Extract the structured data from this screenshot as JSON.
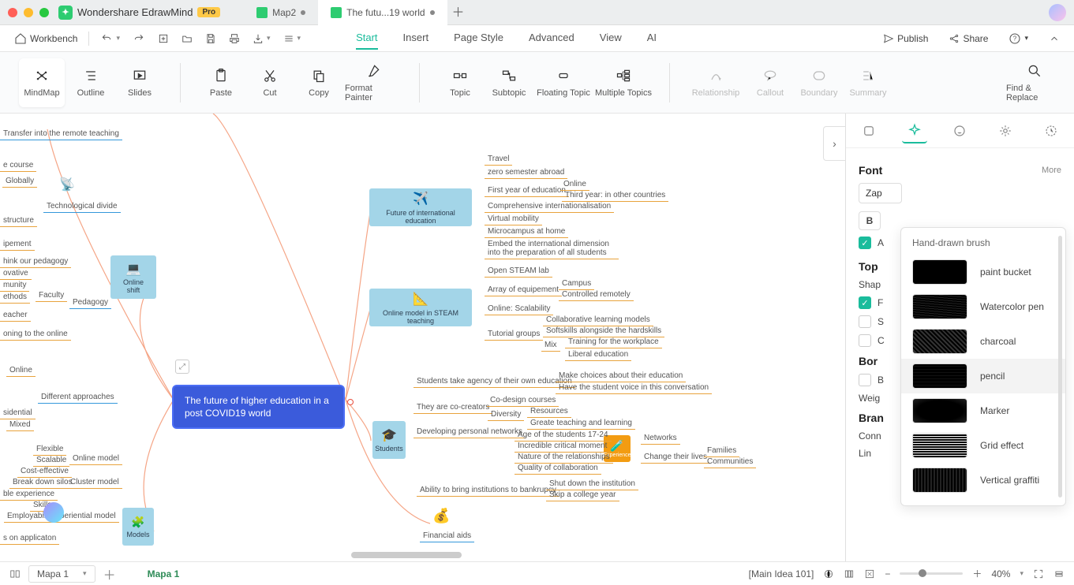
{
  "titlebar": {
    "app_name": "Wondershare EdrawMind",
    "pro": "Pro",
    "tabs": [
      {
        "label": "Map2",
        "active": false,
        "dirty": true
      },
      {
        "label": "The futu...19 world",
        "active": true,
        "dirty": true
      }
    ]
  },
  "menubar": {
    "workbench": "Workbench",
    "tabs": [
      "Start",
      "Insert",
      "Page Style",
      "Advanced",
      "View",
      "AI"
    ],
    "active_tab": "Start",
    "publish": "Publish",
    "share": "Share"
  },
  "toolbar": {
    "mindmap": "MindMap",
    "outline": "Outline",
    "slides": "Slides",
    "paste": "Paste",
    "cut": "Cut",
    "copy": "Copy",
    "format_painter": "Format Painter",
    "topic": "Topic",
    "subtopic": "Subtopic",
    "floating": "Floating Topic",
    "multiple": "Multiple Topics",
    "relationship": "Relationship",
    "callout": "Callout",
    "boundary": "Boundary",
    "summary": "Summary",
    "find": "Find & Replace"
  },
  "main": {
    "title": "The future of higher education in a post COVID19 world"
  },
  "topics": {
    "online_shift": "Online shift",
    "models": "Models",
    "students": "Students",
    "future_intl": "Future of international education",
    "online_steam": "Online model in STEAM teaching",
    "financial": "Financial aids",
    "experience": "Experience"
  },
  "left_nodes": {
    "transfer": "Transfer into the remote teaching",
    "course": "e course",
    "globally": "Globally",
    "structure": "structure",
    "ipement": "ipement",
    "tech_divide": "Technological divide",
    "hink": "hink our pedagogy",
    "ovative": "ovative",
    "munity": "munity",
    "ethods": "ethods",
    "eacher": "eacher",
    "oning": "oning to the online",
    "faculty": "Faculty",
    "pedagogy": "Pedagogy",
    "online": "Online",
    "diff": "Different approaches",
    "sidential": "sidential",
    "mixed": "Mixed",
    "flexible": "Flexible",
    "scalable": "Scalable",
    "cost": "Cost-effective",
    "break": "Break down silos",
    "ble": "ble experience",
    "skills": "Skills",
    "employ": "Employability",
    "app": "s on applicaton",
    "online_model": "Online model",
    "cluster": "Cluster model",
    "periential": "periential model"
  },
  "right_nodes": {
    "travel": "Travel",
    "zero": "zero semester abroad",
    "first_year": "First year of education",
    "online": "Online",
    "third_year": "Third year: in other countries",
    "compr": "Comprehensive internationalisation",
    "vm": "Virtual mobility",
    "micro": "Microcampus at home",
    "embed": "Embed the international dimension into the preparation of all students",
    "open": "Open STEAM lab",
    "array": "Array of equipement",
    "campus": "Campus",
    "remote": "Controlled remotely",
    "scal": "Online: Scalability",
    "tutorial": "Tutorial groups",
    "collab": "Collaborative learning models",
    "soft": "Softskills alongside the hardskills",
    "mix": "Mix",
    "training": "Training for the workplace",
    "liberal": "Liberal education",
    "agency": "Students take agency of their own education",
    "make": "Make choices about their education",
    "voice": "Have the student voice in this conversation",
    "cocreators": "They are co-creators",
    "codesign": "Co-design courses",
    "diversity": "Diversity",
    "resources": "Resources",
    "greate": "Greate teaching and learning",
    "develop": "Developing personal networks",
    "age": "Age of the students 17-24",
    "critical": "Incredible critical moment",
    "nature": "Nature of the relationships",
    "quality": "Quality of collaboration",
    "networks": "Networks",
    "change": "Change their lives",
    "families": "Families",
    "communities": "Communities",
    "bring": "Ability to bring institutions to bankrupcy",
    "shut": "Shut down the institution",
    "skip": "Skip a college year"
  },
  "rpanel": {
    "font": "Font",
    "more": "More",
    "font_name": "Zap",
    "auto": "A",
    "auto_on": true,
    "topics": "Top",
    "shape": "Shap",
    "f_on": true,
    "s": "S",
    "c": "C",
    "border": "Bor",
    "b": "B",
    "weight": "Weig",
    "branch": "Bran",
    "conn": "Conn",
    "lin": "Lin"
  },
  "brush": {
    "title": "Hand-drawn brush",
    "items": [
      "paint bucket",
      "Watercolor pen",
      "charcoal",
      "pencil",
      "Marker",
      "Grid effect",
      "Vertical graffiti"
    ],
    "selected": "pencil"
  },
  "status": {
    "sheet": "Mapa 1",
    "sheet_active": "Mapa 1",
    "mainidea": "[Main Idea 101]",
    "zoom": "40%"
  }
}
